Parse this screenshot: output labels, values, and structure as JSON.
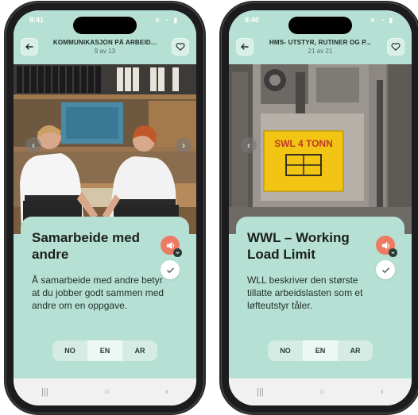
{
  "left_screen": {
    "status": {
      "time": "8:41",
      "icons": "✕ ◔ ▮"
    },
    "header": {
      "title": "KOMMUNIKASJON PÅ ARBEID...",
      "counter": "9 av 13"
    },
    "card": {
      "title": "Samarbeide med andre",
      "body": "Å samarbeide med andre betyr at du jobber godt sammen med andre om en oppgave."
    },
    "languages": [
      {
        "label": "NO",
        "active": false
      },
      {
        "label": "EN",
        "active": true
      },
      {
        "label": "AR",
        "active": false
      }
    ]
  },
  "right_screen": {
    "status": {
      "time": "8:40",
      "icons": "✕ ◔ ▮"
    },
    "header": {
      "title": "HMS- UTSTYR, RUTINER OG P...",
      "counter": "21 av 21"
    },
    "sign": {
      "text": "SWL 4 TONN"
    },
    "card": {
      "title": "WWL – Working Load Limit",
      "body": "WLL beskriver den største tillatte arbeidslasten som et løfteutstyr tåler."
    },
    "languages": [
      {
        "label": "NO",
        "active": false
      },
      {
        "label": "EN",
        "active": true
      },
      {
        "label": "AR",
        "active": false
      }
    ]
  },
  "nav_glyphs": {
    "recents": "|||",
    "home": "○",
    "back": "‹"
  },
  "colors": {
    "app_background": "#b6e0d3",
    "audio_button": "#ed7b64",
    "language_active": "#edf7f3",
    "sign_yellow": "#f2c414"
  },
  "icons": [
    "back-arrow-icon",
    "heart-icon",
    "speaker-icon",
    "chevron-down-icon",
    "check-icon",
    "chevron-left-icon",
    "chevron-right-icon"
  ]
}
